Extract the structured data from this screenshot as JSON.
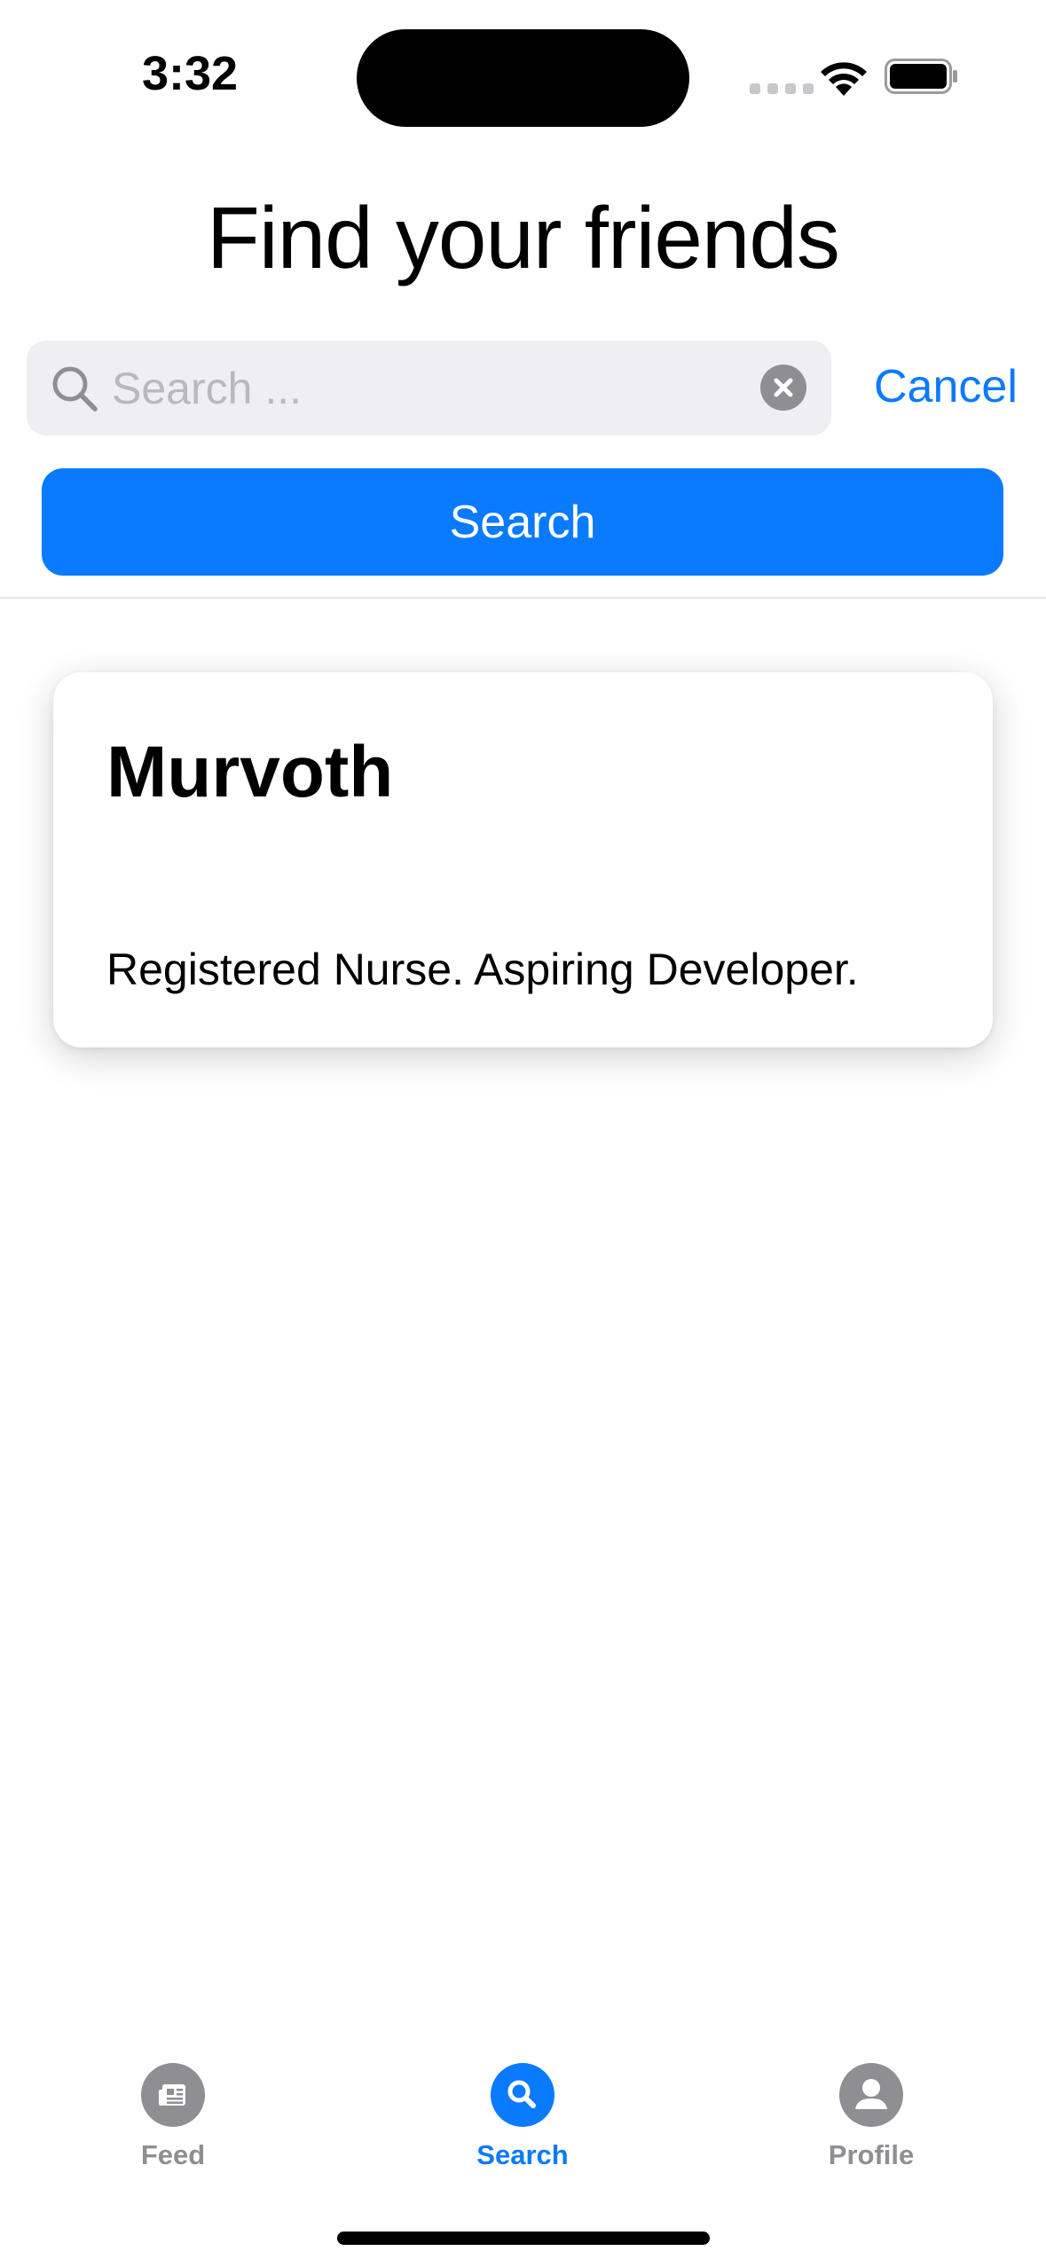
{
  "status_bar": {
    "time": "3:32",
    "icons": [
      "cellular-signal-icon",
      "wifi-icon",
      "battery-icon"
    ]
  },
  "header": {
    "title": "Find your friends"
  },
  "search": {
    "placeholder": "Search ...",
    "value": "",
    "cancel_label": "Cancel",
    "button_label": "Search"
  },
  "results": [
    {
      "name": "Murvoth",
      "bio": "Registered Nurse. Aspiring Developer."
    }
  ],
  "tab_bar": {
    "items": [
      {
        "label": "Feed",
        "icon": "newspaper-icon",
        "active": false
      },
      {
        "label": "Search",
        "icon": "magnifying-glass-icon",
        "active": true
      },
      {
        "label": "Profile",
        "icon": "person-icon",
        "active": false
      }
    ]
  },
  "colors": {
    "accent": "#0a7aff",
    "inactive": "#8e8e93",
    "field_background": "#eeeef3"
  }
}
